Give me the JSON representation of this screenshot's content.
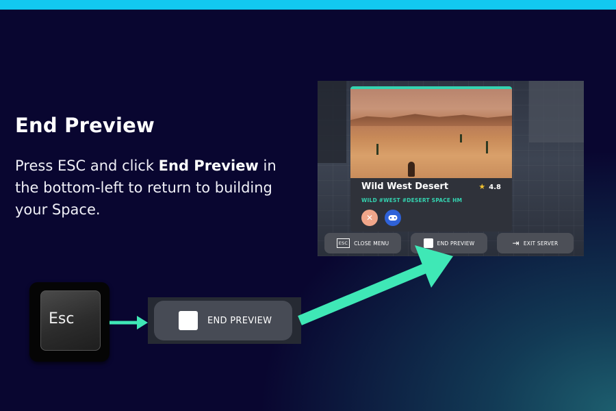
{
  "heading": "End Preview",
  "description": {
    "part1": "Press ESC and click ",
    "bold": "End Preview",
    "part2": " in the bottom-left to return to building your Space."
  },
  "esc_key": {
    "label": "Esc"
  },
  "zoom_button": {
    "label": "END PREVIEW"
  },
  "game": {
    "card": {
      "title": "Wild West Desert",
      "rating": "4.8",
      "tags": "WILD #WEST #DESERT SPACE HM"
    },
    "buttons": {
      "close_menu_key": "ESC",
      "close_menu": "CLOSE MENU",
      "end_preview": "END PREVIEW",
      "exit_server": "EXIT SERVER"
    }
  },
  "colors": {
    "top_bar": "#12c8f0",
    "arrow": "#3fe8b6",
    "tag_accent": "#34d3b0",
    "background": "#090630"
  },
  "icons": [
    "esc-key-icon",
    "arrow-right-icon",
    "big-arrow-icon",
    "star-icon",
    "tools-icon",
    "gamepad-icon",
    "exit-door-icon"
  ]
}
